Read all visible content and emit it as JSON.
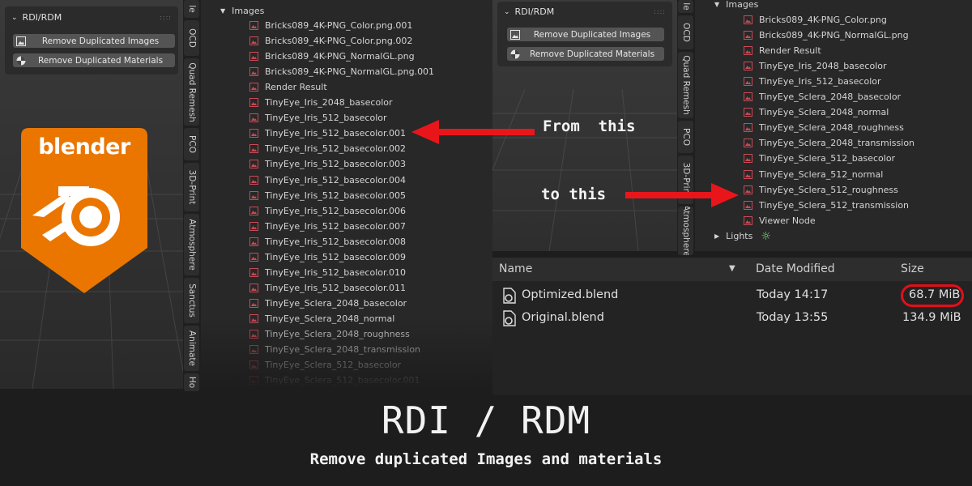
{
  "addon_panel_left": {
    "title": "RDI/RDM",
    "buttons": [
      {
        "label": "Remove Duplicated Images",
        "icon": "image-icon"
      },
      {
        "label": "Remove Duplicated Materials",
        "icon": "material-icon"
      }
    ]
  },
  "addon_panel_right": {
    "title": "RDI/RDM",
    "buttons": [
      {
        "label": "Remove Duplicated Images",
        "icon": "image-icon"
      },
      {
        "label": "Remove Duplicated Materials",
        "icon": "material-icon"
      }
    ]
  },
  "logo": {
    "text": "blender",
    "color": "#ea7600"
  },
  "tabs_left": [
    "le",
    "OCD",
    "Quad Remesh",
    "PCO",
    "3D-Print",
    "Atmosphere",
    "Sanctus",
    "Animate",
    "Ho"
  ],
  "tabs_right": [
    "le",
    "OCD",
    "Quad Remesh",
    "PCO",
    "3D-Print",
    "Atmosphere"
  ],
  "outliner_left": {
    "group": "Images",
    "items": [
      "Bricks089_4K-PNG_Color.png.001",
      "Bricks089_4K-PNG_Color.png.002",
      "Bricks089_4K-PNG_NormalGL.png",
      "Bricks089_4K-PNG_NormalGL.png.001",
      "Render Result",
      "TinyEye_Iris_2048_basecolor",
      "TinyEye_Iris_512_basecolor",
      "TinyEye_Iris_512_basecolor.001",
      "TinyEye_Iris_512_basecolor.002",
      "TinyEye_Iris_512_basecolor.003",
      "TinyEye_Iris_512_basecolor.004",
      "TinyEye_Iris_512_basecolor.005",
      "TinyEye_Iris_512_basecolor.006",
      "TinyEye_Iris_512_basecolor.007",
      "TinyEye_Iris_512_basecolor.008",
      "TinyEye_Iris_512_basecolor.009",
      "TinyEye_Iris_512_basecolor.010",
      "TinyEye_Iris_512_basecolor.011",
      "TinyEye_Sclera_2048_basecolor",
      "TinyEye_Sclera_2048_normal",
      "TinyEye_Sclera_2048_roughness",
      "TinyEye_Sclera_2048_transmission",
      "TinyEye_Sclera_512_basecolor",
      "TinyEye_Sclera_512_basecolor.001"
    ]
  },
  "outliner_right": {
    "group": "Images",
    "items": [
      "Bricks089_4K-PNG_Color.png",
      "Bricks089_4K-PNG_NormalGL.png",
      "Render Result",
      "TinyEye_Iris_2048_basecolor",
      "TinyEye_Iris_512_basecolor",
      "TinyEye_Sclera_2048_basecolor",
      "TinyEye_Sclera_2048_normal",
      "TinyEye_Sclera_2048_roughness",
      "TinyEye_Sclera_2048_transmission",
      "TinyEye_Sclera_512_basecolor",
      "TinyEye_Sclera_512_normal",
      "TinyEye_Sclera_512_roughness",
      "TinyEye_Sclera_512_transmission",
      "Viewer Node"
    ],
    "next_group": "Lights"
  },
  "annotations": {
    "from": "From  this",
    "to": "to this",
    "arrow_color": "#e8161b"
  },
  "file_browser": {
    "columns": {
      "name": "Name",
      "date": "Date Modified",
      "size": "Size"
    },
    "rows": [
      {
        "name": "Optimized.blend",
        "date": "Today 14:17",
        "size": "68.7 MiB",
        "highlighted": true
      },
      {
        "name": "Original.blend",
        "date": "Today 13:55",
        "size": "134.9 MiB",
        "highlighted": false
      }
    ]
  },
  "footer": {
    "title": "RDI / RDM",
    "subtitle": "Remove duplicated Images and materials"
  },
  "colors": {
    "image_icon": "#c94a55",
    "highlight_ring": "#e0101a"
  }
}
